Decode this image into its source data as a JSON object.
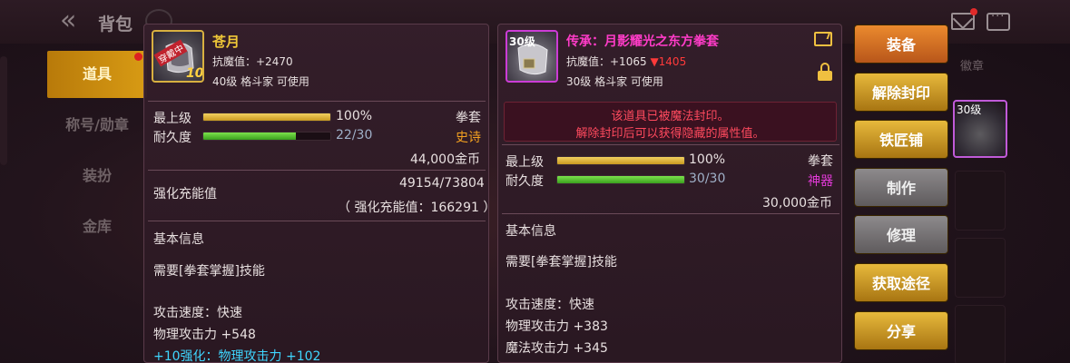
{
  "top": {
    "back_title": "背包"
  },
  "sidebar": {
    "items": [
      {
        "label": "道具",
        "active": true
      },
      {
        "label": "称号/勋章",
        "active": false
      },
      {
        "label": "装扮",
        "active": false
      },
      {
        "label": "金库",
        "active": false
      }
    ]
  },
  "right_panel": {
    "tab_label": "徽章",
    "slot_label": "30级"
  },
  "left_item": {
    "badge": "穿戴中",
    "level_badge": "10",
    "name": "苍月",
    "magic_resist": "抗魔值：+2470",
    "requirement": "40级 格斗家 可使用",
    "max_level_label": "最上级",
    "max_level_value": "100%",
    "max_level_fill": 1.0,
    "durability_label": "耐久度",
    "durability_value": "22/30",
    "durability_fill": 0.73,
    "type": "拳套",
    "rarity": "史诗",
    "price": "44,000金币",
    "charge_label": "强化充能值",
    "charge_value": "49154/73804",
    "charge_detail": "（ 强化充能值：166291 ）",
    "basic_info_title": "基本信息",
    "skill_req": "需要[拳套掌握]技能",
    "attack_speed": "攻击速度：快速",
    "phys_attack": "物理攻击力 +548",
    "enhance": "+10强化：物理攻击力 +102"
  },
  "right_item": {
    "level_badge": "30级",
    "name": "传承：月影耀光之东方拳套",
    "magic_resist": "抗魔值：+1065",
    "magic_resist_diff": "▼1405",
    "requirement": "30级 格斗家 可使用",
    "seal_line1": "该道具已被魔法封印。",
    "seal_line2": "解除封印后可以获得隐藏的属性值。",
    "max_level_label": "最上级",
    "max_level_value": "100%",
    "max_level_fill": 1.0,
    "durability_label": "耐久度",
    "durability_value": "30/30",
    "durability_fill": 1.0,
    "type": "拳套",
    "rarity": "神器",
    "price": "30,000金币",
    "basic_info_title": "基本信息",
    "skill_req": "需要[拳套掌握]技能",
    "attack_speed": "攻击速度：快速",
    "phys_attack": "物理攻击力 +383",
    "magic_attack": "魔法攻击力 +345"
  },
  "actions": [
    {
      "label": "装备",
      "style": "orange"
    },
    {
      "label": "解除封印",
      "style": "gold"
    },
    {
      "label": "铁匠铺",
      "style": "gold"
    },
    {
      "label": "制作",
      "style": "gray"
    },
    {
      "label": "修理",
      "style": "gray"
    },
    {
      "label": "获取途径",
      "style": "gold"
    },
    {
      "label": "分享",
      "style": "gold"
    }
  ],
  "colors": {
    "item_name": "#f0c838",
    "epic": "#f2a020",
    "artifact": "#e33ad8",
    "magenta_name": "#ff3cc8",
    "seal_text": "#ff4a5e",
    "enhance_text": "#3fd6ff",
    "decrease": "#ff3a3a"
  }
}
